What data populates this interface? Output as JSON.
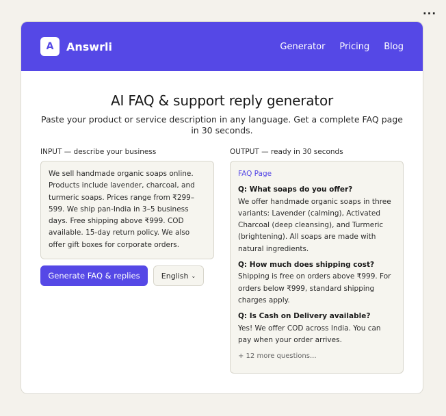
{
  "toolbar": {
    "more": "···"
  },
  "header": {
    "logo_letter": "A",
    "brand": "Answrli",
    "nav": [
      "Generator",
      "Pricing",
      "Blog"
    ]
  },
  "hero": {
    "title": "AI FAQ & support reply generator",
    "subtitle": "Paste your product or service description in any language. Get a complete FAQ page in 30 seconds."
  },
  "input": {
    "label": "INPUT — describe your business",
    "text": "We sell handmade organic soaps online. Products include lavender, charcoal, and turmeric soaps. Prices range from ₹299–599. We ship pan-India in 3–5 business days. Free shipping above ₹999. COD available. 15-day return policy. We also offer gift boxes for corporate orders.",
    "generate_label": "Generate FAQ & replies",
    "language": "English",
    "chevron": "⌄"
  },
  "output": {
    "label": "OUTPUT — ready in 30 seconds",
    "heading": "FAQ Page",
    "qas": [
      {
        "q": "Q: What soaps do you offer?",
        "a": "We offer handmade organic soaps in three variants: Lavender (calming), Activated Charcoal (deep cleansing), and Turmeric (brightening). All soaps are made with natural ingredients."
      },
      {
        "q": "Q: How much does shipping cost?",
        "a": "Shipping is free on orders above ₹999. For orders below ₹999, standard shipping charges apply."
      },
      {
        "q": "Q: Is Cash on Delivery available?",
        "a": "Yes! We offer COD across India. You can pay when your order arrives."
      }
    ],
    "more": "+ 12 more questions..."
  }
}
